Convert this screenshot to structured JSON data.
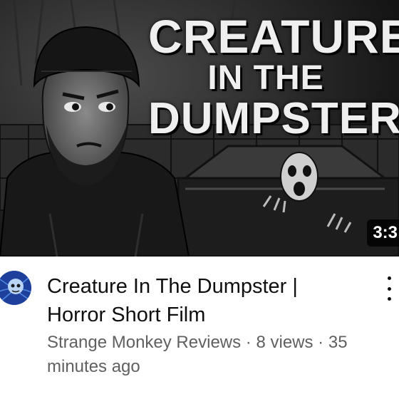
{
  "thumbnail": {
    "title_line1": "CREATURE",
    "title_line2": "IN THE",
    "title_line3": "DUMPSTER",
    "duration": "3:3"
  },
  "video": {
    "title": "Creature In The Dumpster | Horror Short Film",
    "channel": "Strange Monkey Reviews",
    "views": "8 views",
    "age": "35 minutes ago",
    "separator": "·"
  },
  "icons": {
    "menu": "more-vert-icon",
    "avatar": "channel-avatar"
  },
  "colors": {
    "title_text": "#0f0f0f",
    "meta_text": "#606060",
    "background": "#ffffff"
  }
}
